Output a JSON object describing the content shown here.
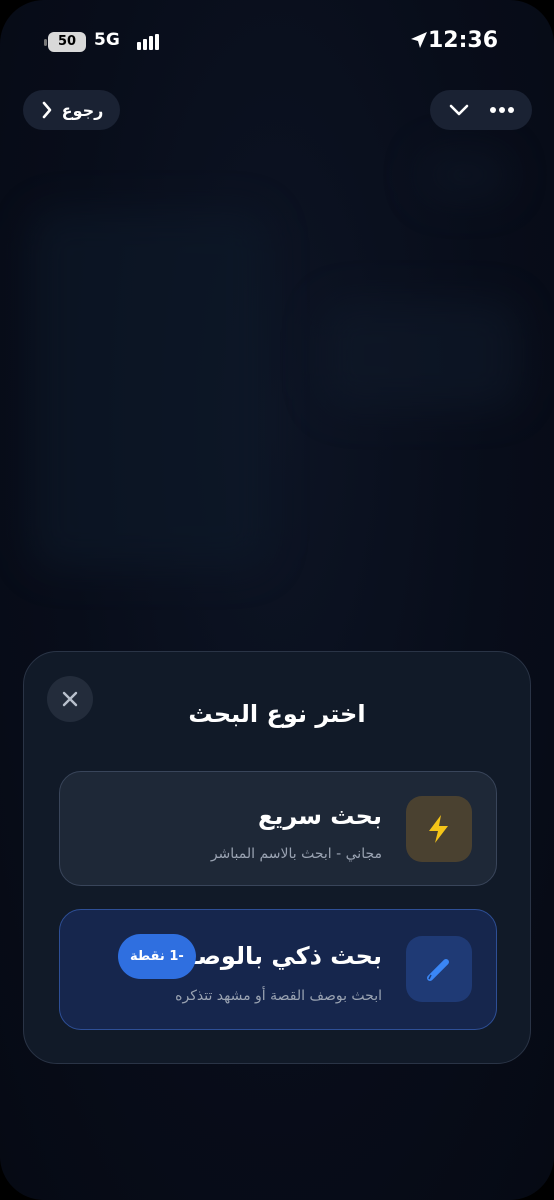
{
  "status_bar": {
    "battery": "50",
    "network": "5G",
    "time": "12:36"
  },
  "nav": {
    "back_label": "رجوع"
  },
  "sheet": {
    "title": "اختر نوع البحث",
    "options": [
      {
        "title": "بحث سريع",
        "subtitle": "مجاني - ابحث بالاسم المباشر",
        "icon": "lightning-icon"
      },
      {
        "title": "بحث ذكي بالوصف",
        "subtitle": "ابحث بوصف القصة أو مشهد تتذكره",
        "badge": "-1 نقطة",
        "icon": "pencil-icon"
      }
    ]
  },
  "colors": {
    "accent_blue": "#2f6fe0",
    "lightning_yellow": "#f5c518",
    "sheet_bg": "#111a28"
  }
}
